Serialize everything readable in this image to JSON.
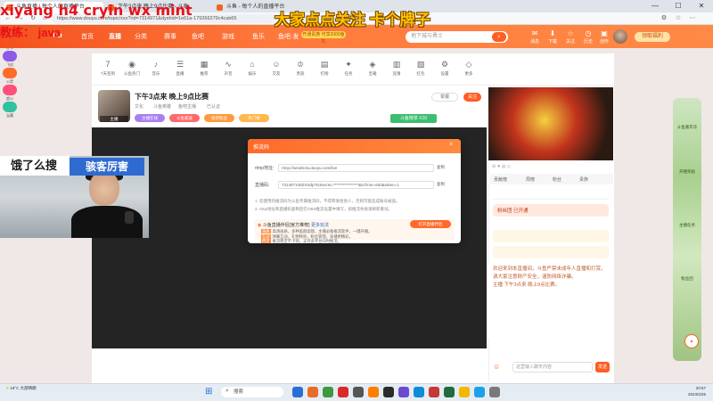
{
  "overlay": {
    "line1": "xiyang h4 cryin wx mint",
    "line2": "教练： java",
    "banner_center": "大家点点关注 卡个牌子",
    "webcam_left": "饿了么搜",
    "webcam_right": "骇客厉害"
  },
  "browser": {
    "tabs": [
      {
        "label": "斗鱼直播 | 每个人的直播平台"
      },
      {
        "label": "下午3点来 晚上9点比赛 - 斗鱼"
      },
      {
        "label": "斗鱼 - 每个人的直播平台"
      }
    ],
    "url": "https://www.douyu.com/topic/xxx?rid=7314971&dyshid=1e61a-179266279c4cab65",
    "controls": [
      "—",
      "☐",
      "✕"
    ]
  },
  "site": {
    "nav": [
      "首页",
      "直播",
      "分类",
      "赛事",
      "鱼吧",
      "游戏",
      "鱼乐",
      "鱼吧·发"
    ],
    "search_placeholder": "地下城与勇士",
    "vip_badge": "开通贵族 可享2000鱼丸",
    "header_icons": [
      {
        "icon": "✉",
        "label": "消息"
      },
      {
        "icon": "⬇",
        "label": "下载"
      },
      {
        "icon": "☆",
        "label": "关注"
      },
      {
        "icon": "◷",
        "label": "历史"
      },
      {
        "icon": "▣",
        "label": "创作"
      }
    ],
    "login_label": "领取福利"
  },
  "categories": [
    {
      "icon": "7",
      "label": "7天签到"
    },
    {
      "icon": "◉",
      "label": "斗鱼热门"
    },
    {
      "icon": "♪",
      "label": "音乐"
    },
    {
      "icon": "☰",
      "label": "直播"
    },
    {
      "icon": "▦",
      "label": "推荐"
    },
    {
      "icon": "∿",
      "label": "声音"
    },
    {
      "icon": "⌂",
      "label": "娱乐"
    },
    {
      "icon": "☺",
      "label": "交友"
    },
    {
      "icon": "♔",
      "label": "贵族"
    },
    {
      "icon": "▤",
      "label": "打榜"
    },
    {
      "icon": "✦",
      "label": "任务"
    },
    {
      "icon": "◈",
      "label": "宝箱"
    },
    {
      "icon": "▥",
      "label": "竞猜"
    },
    {
      "icon": "▧",
      "label": "红包"
    },
    {
      "icon": "⚙",
      "label": "设置"
    },
    {
      "icon": "◇",
      "label": "更多"
    }
  ],
  "stream": {
    "title": "下午3点来 晚上9点比赛",
    "meta": [
      "文化",
      "斗鱼英雄",
      "鱼吧主播",
      "已认证"
    ],
    "streamer_tag": "主播",
    "pills": [
      "主播在线",
      "斗鱼家族",
      "鱼吧粉丝",
      "热门榜"
    ],
    "rank_tag": "斗鱼榜单 X10",
    "follow_label": "关注",
    "report_label": "举报"
  },
  "gifts": [
    {
      "label": "鱼翅",
      "color": "#7ac142"
    },
    {
      "label": "荧光棒",
      "color": "#ffb331"
    },
    {
      "label": "办卡",
      "color": "#52a3ff"
    },
    {
      "label": "飞机",
      "color": "#8e5ae8"
    },
    {
      "label": "火箭",
      "color": "#ff6a2a"
    },
    {
      "label": "超火",
      "color": "#ff4f7c"
    },
    {
      "label": "宝藏",
      "color": "#30c29e"
    }
  ],
  "sidebar": {
    "tabs": [
      "贡献榜",
      "周榜",
      "粉丝",
      "贵族"
    ],
    "rank_label": "粉丝团 已开通",
    "chat_lines": [
      "欢迎来到本直播间，斗鱼严禁未成年人直播和打赏。",
      "请大家注意财产安全，谨防网络诈骗。",
      "主播 下午3点来 晚上9点比赛。"
    ],
    "chat_placeholder": "这里输入聊天内容",
    "send_label": "发送"
  },
  "deco_labels": [
    "斗鱼嘉年华",
    "开播奖励",
    "主播任务",
    "粉丝团"
  ],
  "modal": {
    "title": "推流码",
    "close": "×",
    "fields": [
      {
        "label": "rtmp地址:",
        "value": "rtmp://sendtc3a.douyu.com/live",
        "action": "复制"
      },
      {
        "label": "直播码:",
        "value": "7314971rt8ZXSdp?txSecret=****************&txTime=65d&token=1",
        "action": "复制"
      }
    ],
    "notes": [
      "1. 您使用的推流码为斗鱼专属推流码，不得转发给他人，否则可能造成账号被盗。",
      "2. rtmp地址和直播码复制后在OBS推流设置中填写，如推流失败请刷新重试。"
    ],
    "promo_title": "斗鱼直播伴侣[官方推荐]",
    "promo_sub": "更多玩法",
    "promo_btn": "打开直播伴侣",
    "promo_lines": [
      {
        "tag": "画质",
        "text": "高清画质，多种美颜滤镜，主播必备推流软件，一键开播。"
      },
      {
        "tag": "互动",
        "text": "弹幕互动，礼物特效，粉丝管理，直播更精彩。"
      },
      {
        "tag": "稳定",
        "text": "推流稳定不卡顿，支持多平台同时推流。"
      }
    ]
  },
  "taskbar": {
    "weather": "19°C 大部晴朗",
    "search": "搜索",
    "time": "20:57",
    "date": "2023/4/25",
    "apps": [
      "#2a6fd6",
      "#e96b2a",
      "#3c9a3c",
      "#d92a2a",
      "#555555",
      "#ff7f00",
      "#2b2b2b",
      "#6b4bd0",
      "#0a8dd4",
      "#c43838",
      "#1f6b3f",
      "#f2b800",
      "#1aa3e8",
      "#7a7a7a"
    ]
  }
}
